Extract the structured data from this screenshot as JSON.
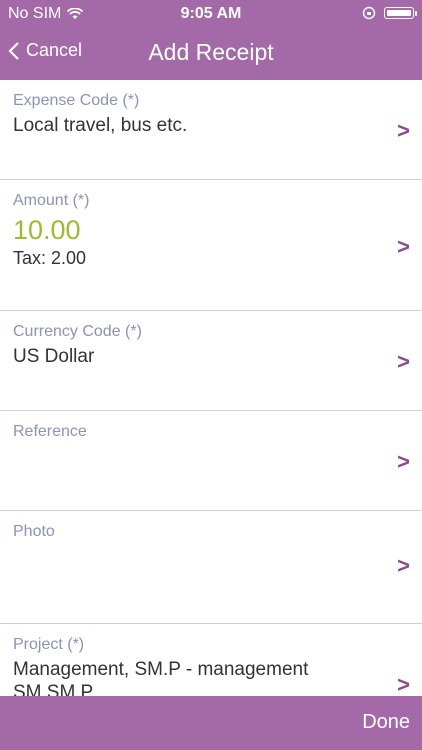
{
  "status": {
    "carrier": "No SIM",
    "time": "9:05 AM"
  },
  "nav": {
    "back_label": "Cancel",
    "title": "Add Receipt"
  },
  "rows": [
    {
      "label": "Expense Code (*)",
      "value": "Local travel, bus etc."
    },
    {
      "label": "Amount (*)",
      "value": "10.00",
      "sub": "Tax: 2.00"
    },
    {
      "label": "Currency Code (*)",
      "value": "US Dollar"
    },
    {
      "label": "Reference",
      "value": ""
    },
    {
      "label": "Photo",
      "value": ""
    },
    {
      "label": "Project (*)",
      "value": "Management, SM.P - management",
      "value2": "SM.SM.P"
    }
  ],
  "toolbar": {
    "done_label": "Done"
  },
  "colors": {
    "accent": "#a46aa7",
    "amount": "#9bbc2c",
    "chevron": "#8a4a8c"
  }
}
